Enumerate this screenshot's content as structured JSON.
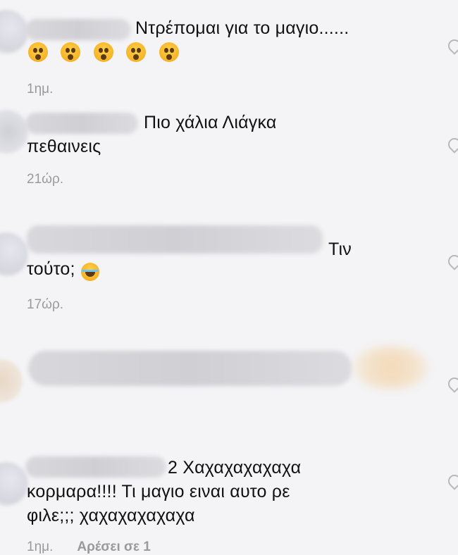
{
  "comments": [
    {
      "text": "Ντρέπομαι για το μαγιο......",
      "emoji_icons": [
        "astonished-face-icon",
        "astonished-face-icon",
        "astonished-face-icon",
        "astonished-face-icon",
        "astonished-face-icon"
      ],
      "time": "1ημ."
    },
    {
      "text_line1": "Πιο χάλια  Λιάγκα",
      "text_line2": "πεθαινεις",
      "time": "21ώρ."
    },
    {
      "text_line1": "Τιν",
      "text_line2": "τούτο;",
      "emoji_icon": "tears-of-joy-icon",
      "time": "17ώρ."
    },
    {
      "blurred": true
    },
    {
      "text_line1": "2 Χαχαχαχαχαχα",
      "text_line2": "κορμαρα!!!! Τι μαγιο ειναι αυτο ρε",
      "text_line3": "φιλε;;; χαχαχαχαχαχα",
      "time": "1ημ.",
      "likes": "Αρέσει σε 1"
    }
  ],
  "icons": {
    "like": "heart-icon"
  }
}
